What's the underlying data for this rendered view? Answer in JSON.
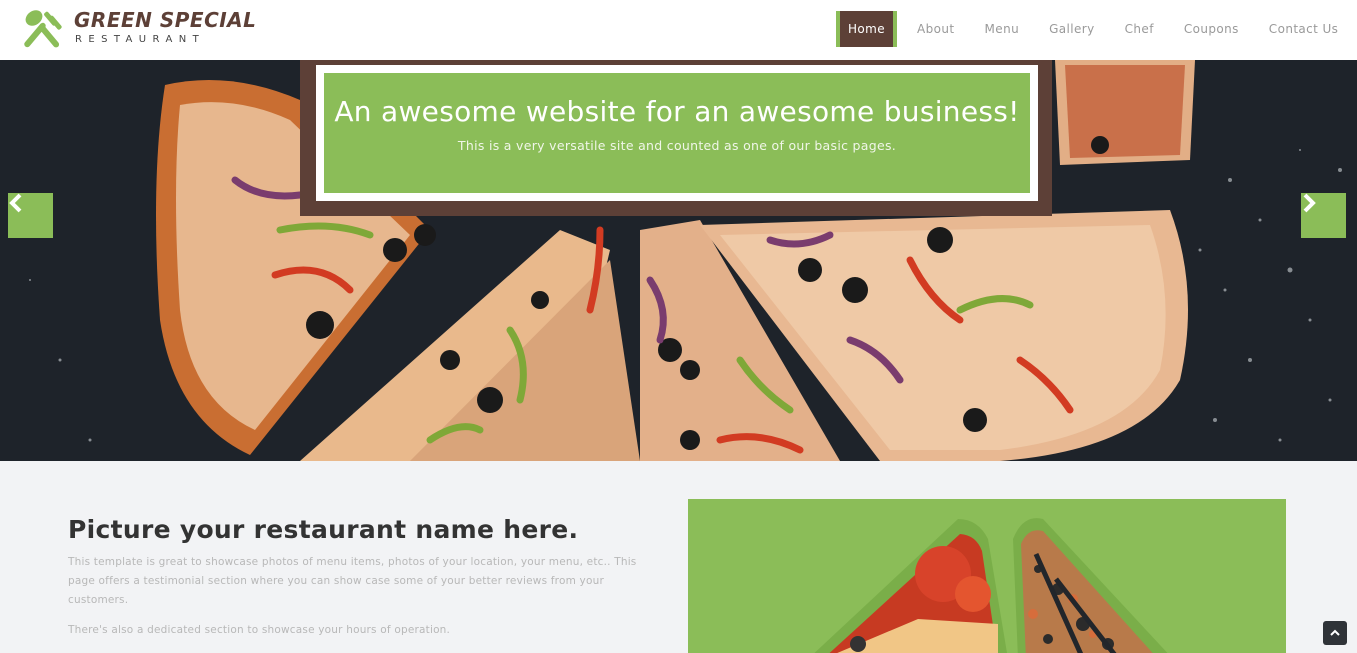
{
  "header": {
    "logo_title": "GREEN SPECIAL",
    "logo_subtitle": "RESTAURANT",
    "logo_icon": "fork-knife-icon",
    "nav": [
      {
        "label": "Home",
        "active": true
      },
      {
        "label": "About",
        "active": false
      },
      {
        "label": "Menu",
        "active": false
      },
      {
        "label": "Gallery",
        "active": false
      },
      {
        "label": "Chef",
        "active": false
      },
      {
        "label": "Coupons",
        "active": false
      },
      {
        "label": "Contact Us",
        "active": false
      }
    ]
  },
  "hero": {
    "title": "An awesome website for an awesome business!",
    "subtitle": "This is a very versatile site and counted as one of our basic pages.",
    "prev_icon": "chevron-left-icon",
    "next_icon": "chevron-right-icon"
  },
  "about": {
    "title": "Picture your restaurant name here.",
    "paragraph1": "This template is great to showcase photos of menu items, photos of your location, your menu, etc.. This page offers a testimonial section where you can show case some of your better reviews from your customers.",
    "paragraph2": "There's also a dedicated section to showcase your hours of operation."
  },
  "scroll_top_icon": "chevron-up-icon",
  "colors": {
    "accent_green": "#8bbd58",
    "brown": "#5d4037",
    "header_bg": "#ffffff",
    "section_bg": "#f2f3f5"
  }
}
